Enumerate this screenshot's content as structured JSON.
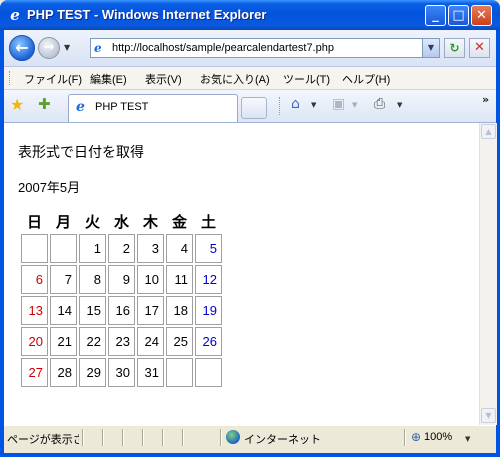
{
  "window": {
    "title": "PHP TEST - Windows Internet Explorer",
    "minimize": "_",
    "maximize": "□",
    "close": "✕"
  },
  "nav": {
    "url": "http://localhost/sample/pearcalendartest7.php"
  },
  "menu": [
    {
      "label": "ファイル(F)"
    },
    {
      "label": "編集(E)"
    },
    {
      "label": "表示(V)"
    },
    {
      "label": "お気に入り(A)"
    },
    {
      "label": "ツール(T)"
    },
    {
      "label": "ヘルプ(H)"
    }
  ],
  "tab": {
    "label": "PHP TEST"
  },
  "icons": [
    "back-icon",
    "forward-icon",
    "refresh-icon",
    "stop-icon",
    "favorites-star-icon",
    "add-favorites-icon",
    "home-icon",
    "feeds-icon",
    "print-icon",
    "globe-icon",
    "zoom-icon"
  ],
  "page": {
    "heading": "表形式で日付を取得",
    "month": "2007年5月",
    "weekdays": [
      "日",
      "月",
      "火",
      "水",
      "木",
      "金",
      "土"
    ],
    "weeks": [
      [
        "",
        "",
        "1",
        "2",
        "3",
        "4",
        "5"
      ],
      [
        "6",
        "7",
        "8",
        "9",
        "10",
        "11",
        "12"
      ],
      [
        "13",
        "14",
        "15",
        "16",
        "17",
        "18",
        "19"
      ],
      [
        "20",
        "21",
        "22",
        "23",
        "24",
        "25",
        "26"
      ],
      [
        "27",
        "28",
        "29",
        "30",
        "31",
        "",
        ""
      ]
    ],
    "colors": {
      "sunday": "#cc0000",
      "saturday": "#0000cc",
      "weekday": "#000000"
    }
  },
  "status": {
    "text": "ページが表示されました",
    "zone": "インターネット",
    "zoom": "100%"
  }
}
